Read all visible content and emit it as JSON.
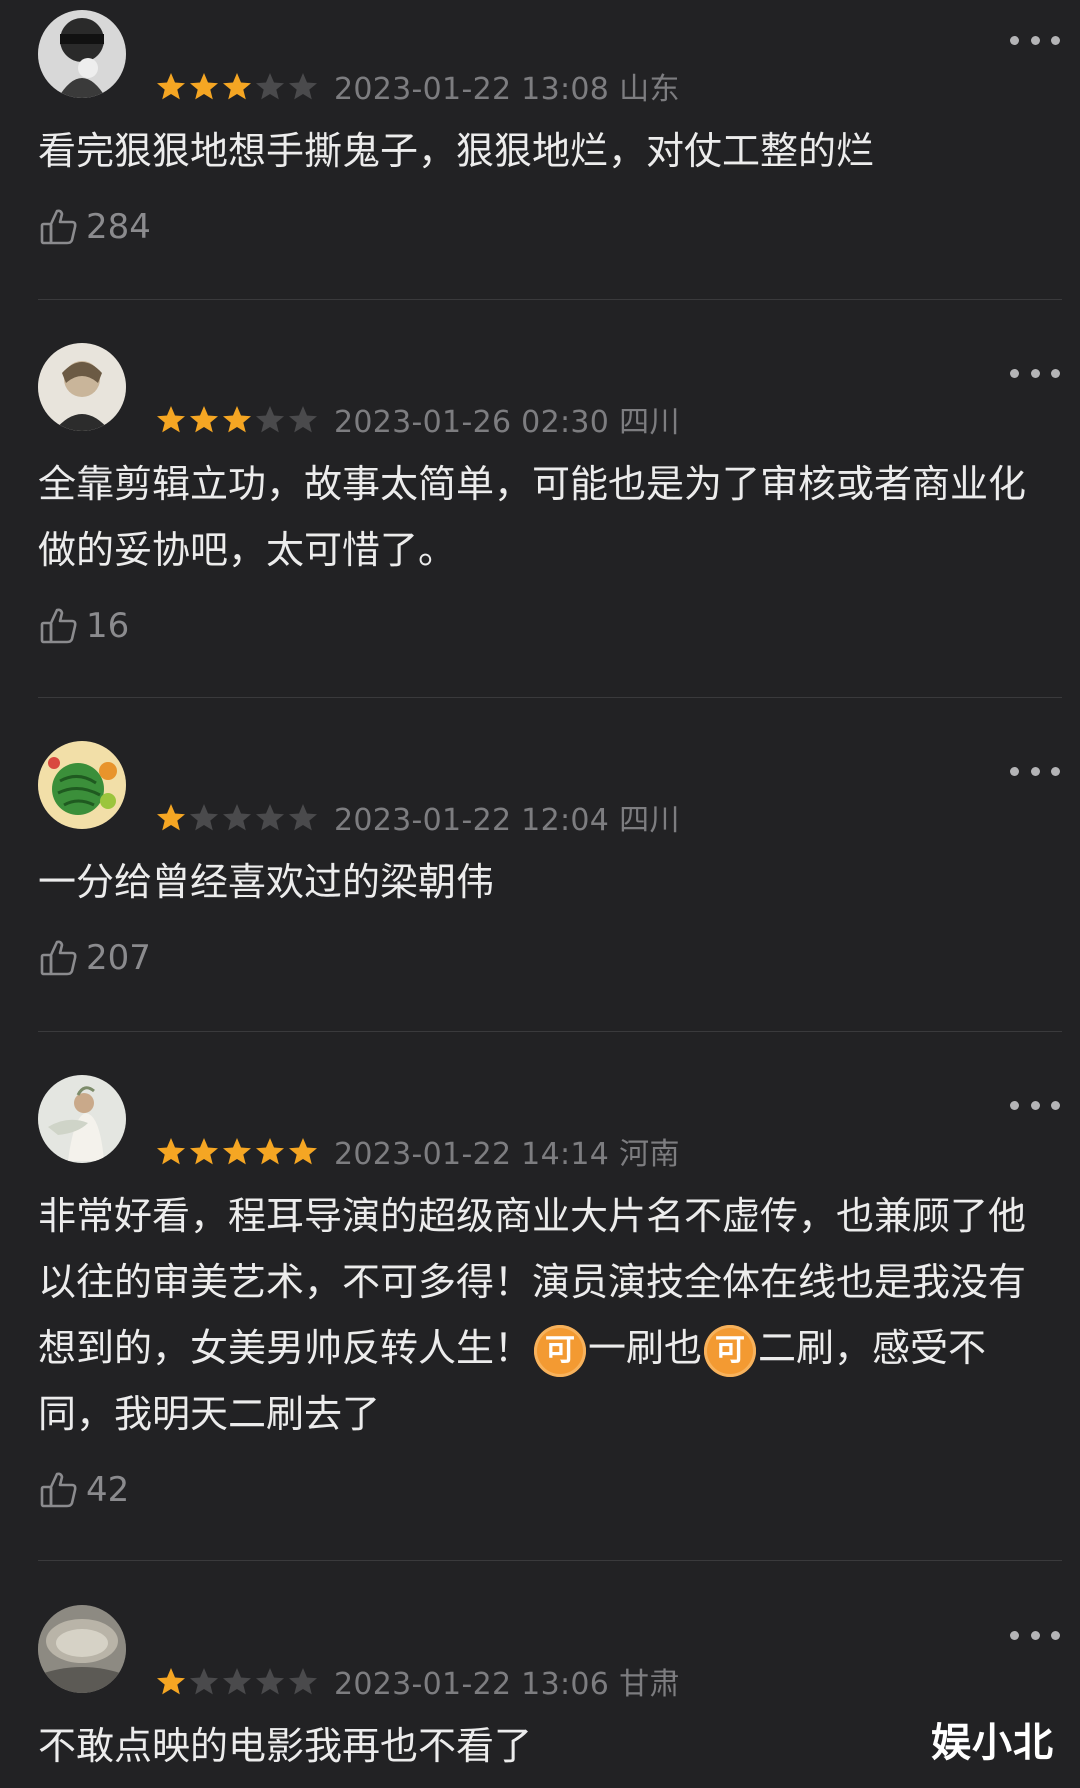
{
  "reviews": [
    {
      "stars": 3,
      "date": "2023-01-22 13:08",
      "location": "山东",
      "content": "看完狠狠地想手撕鬼子，狠狠地烂，对仗工整的烂",
      "likes": "284"
    },
    {
      "stars": 3,
      "date": "2023-01-26 02:30",
      "location": "四川",
      "content": "全靠剪辑立功，故事太简单，可能也是为了审核或者商业化做的妥协吧，太可惜了。",
      "likes": "16"
    },
    {
      "stars": 1,
      "date": "2023-01-22 12:04",
      "location": "四川",
      "content": "一分给曾经喜欢过的梁朝伟",
      "likes": "207"
    },
    {
      "stars": 5,
      "date": "2023-01-22 14:14",
      "location": "河南",
      "content_part1": "非常好看，程耳导演的超级商业大片名不虚传，也兼顾了他以往的审美艺术，不可多得！演员演技全体在线也是我没有想到的，女美男帅反转人生！",
      "emoji_label": "可",
      "content_part2": "一刷也",
      "content_part3": "二刷，感受不同，我明天二刷去了",
      "likes": "42"
    },
    {
      "stars": 1,
      "date": "2023-01-22 13:06",
      "location": "甘肃",
      "content": "不敢点映的电影我再也不看了"
    }
  ],
  "watermark": "娱小北",
  "colors": {
    "background": "#222224",
    "star_filled": "#f5a623",
    "star_empty": "#4a4a4c",
    "meta_text": "#7d7d80",
    "emoji_bg": "#f39a32"
  },
  "icons": [
    "more-icon",
    "thumbs-up-icon",
    "star-icon"
  ]
}
